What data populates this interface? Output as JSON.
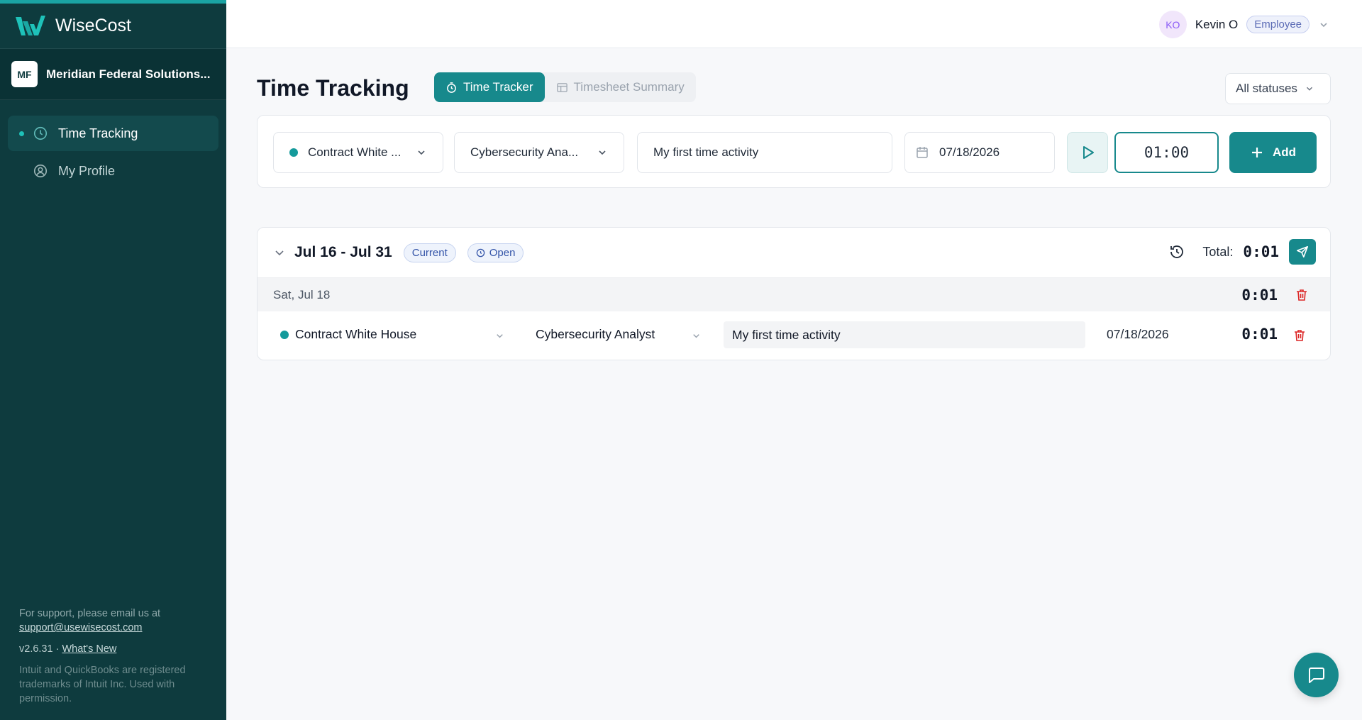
{
  "app": {
    "name": "WiseCost",
    "accent_color": "#17898c",
    "sidebar_color": "#0e3b3e"
  },
  "org": {
    "initials": "MF",
    "name": "Meridian Federal Solutions..."
  },
  "sidebar": {
    "items": [
      {
        "label": "Time Tracking",
        "icon": "clock-icon",
        "active": true
      },
      {
        "label": "My Profile",
        "icon": "user-circle-icon",
        "active": false
      }
    ],
    "support_text": "For support, please email us at",
    "support_email": "support@usewisecost.com",
    "version": "v2.6.31 ·",
    "whats_new": "What's New",
    "trademark": "Intuit and QuickBooks are registered trademarks of Intuit Inc. Used with permission."
  },
  "header": {
    "user_initials": "KO",
    "user_name": "Kevin O",
    "role": "Employee"
  },
  "page": {
    "title": "Time Tracking",
    "tabs": [
      {
        "label": "Time Tracker",
        "icon": "stopwatch-icon",
        "active": true
      },
      {
        "label": "Timesheet Summary",
        "icon": "table-icon",
        "active": false
      }
    ],
    "status_filter": "All statuses"
  },
  "entry_form": {
    "contract": "Contract White ...",
    "role": "Cybersecurity Ana...",
    "description": "My first time activity",
    "date": "07/18/2026",
    "duration": "01:00",
    "add_label": "Add"
  },
  "period": {
    "range": "Jul 16 - Jul 31",
    "current_badge": "Current",
    "status_badge": "Open",
    "total_label": "Total:",
    "total_value": "0:01",
    "days": [
      {
        "label": "Sat, Jul 18",
        "total": "0:01",
        "entries": [
          {
            "contract": "Contract White House",
            "role": "Cybersecurity Analyst",
            "description": "My first time activity",
            "date": "07/18/2026",
            "time": "0:01"
          }
        ]
      }
    ]
  }
}
